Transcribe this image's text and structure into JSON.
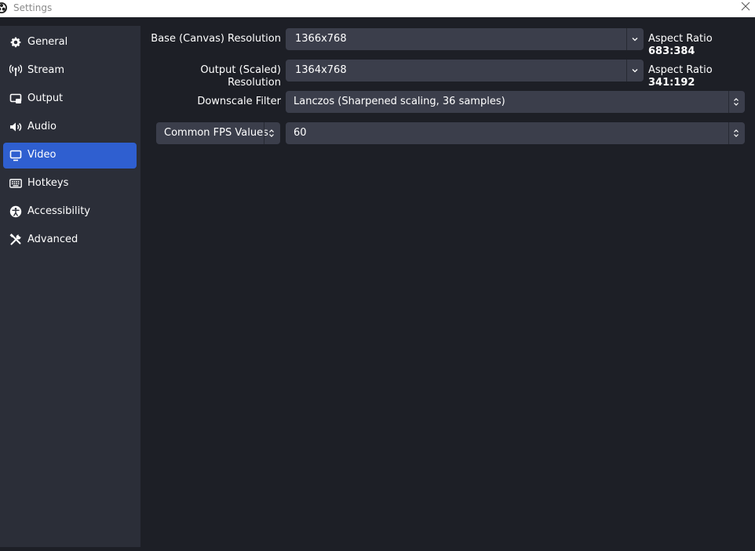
{
  "window": {
    "title": "Settings"
  },
  "sidebar": {
    "items": [
      {
        "label": "General",
        "icon": "gear-icon"
      },
      {
        "label": "Stream",
        "icon": "antenna-icon"
      },
      {
        "label": "Output",
        "icon": "output-icon"
      },
      {
        "label": "Audio",
        "icon": "speaker-icon"
      },
      {
        "label": "Video",
        "icon": "monitor-icon",
        "active": true
      },
      {
        "label": "Hotkeys",
        "icon": "keyboard-icon"
      },
      {
        "label": "Accessibility",
        "icon": "accessibility-icon"
      },
      {
        "label": "Advanced",
        "icon": "tools-icon"
      }
    ]
  },
  "video": {
    "base_resolution": {
      "label": "Base (Canvas) Resolution",
      "value": "1366x768",
      "aspect_prefix": "Aspect Ratio",
      "aspect_value": "683:384"
    },
    "output_resolution": {
      "label": "Output (Scaled) Resolution",
      "value": "1364x768",
      "aspect_prefix": "Aspect Ratio",
      "aspect_value": "341:192"
    },
    "downscale_filter": {
      "label": "Downscale Filter",
      "value": "Lanczos (Sharpened scaling, 36 samples)"
    },
    "fps": {
      "type_label": "Common FPS Values",
      "value": "60"
    }
  },
  "colors": {
    "background": "#1d1f26",
    "sidebar": "#2b2e38",
    "accent": "#2f5fd0",
    "input": "#3b3e4b"
  }
}
